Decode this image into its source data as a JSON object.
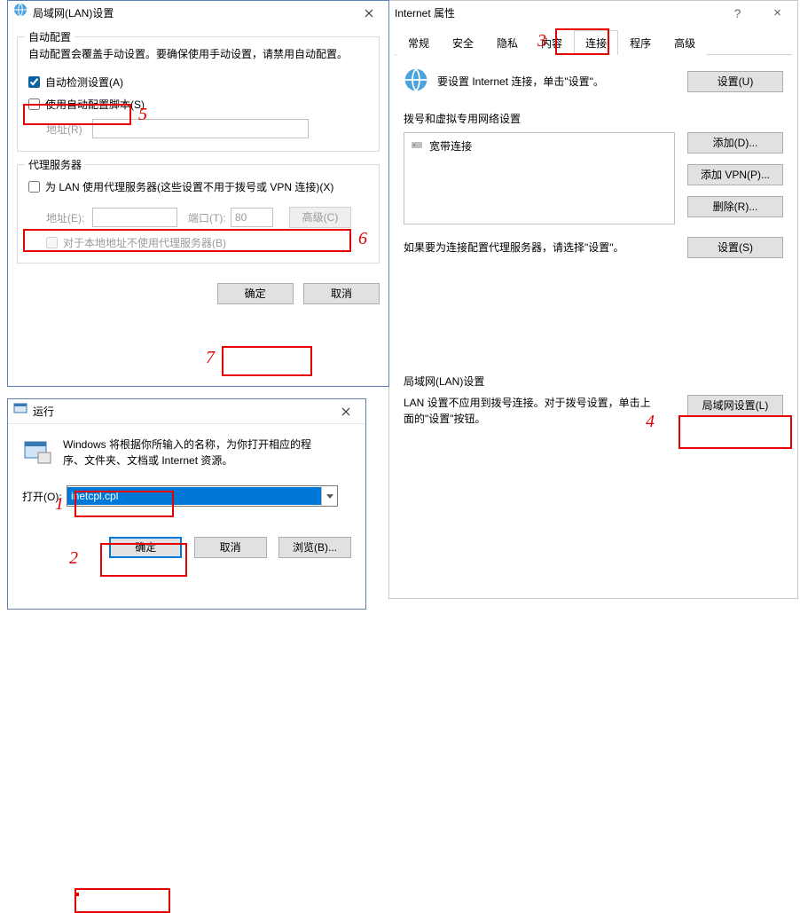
{
  "internet_props": {
    "title": "Internet 属性",
    "help_icon": "?",
    "close_icon": "×",
    "tabs": {
      "general": "常规",
      "security": "安全",
      "privacy": "隐私",
      "content": "内容",
      "connections": "连接",
      "programs": "程序",
      "advanced": "高级"
    },
    "setup_text": "要设置 Internet 连接，单击\"设置\"。",
    "btn_setup": "设置(U)",
    "dialup_legend": "拨号和虚拟专用网络设置",
    "dialup_item": "宽带连接",
    "btn_add": "添加(D)...",
    "btn_add_vpn": "添加 VPN(P)...",
    "btn_delete": "删除(R)...",
    "proxy_note": "如果要为连接配置代理服务器，请选择\"设置\"。",
    "btn_settings": "设置(S)",
    "lan_legend": "局域网(LAN)设置",
    "lan_note": "LAN 设置不应用到拨号连接。对于拨号设置，单击上面的\"设置\"按钮。",
    "btn_lan": "局域网设置(L)"
  },
  "lan_dialog": {
    "title": "局域网(LAN)设置",
    "auto_legend": "自动配置",
    "auto_note": "自动配置会覆盖手动设置。要确保使用手动设置，请禁用自动配置。",
    "chk_auto_detect": "自动检测设置(A)",
    "chk_auto_script": "使用自动配置脚本(S)",
    "addr_label": "地址(R)",
    "proxy_legend": "代理服务器",
    "chk_proxy": "为 LAN 使用代理服务器(这些设置不用于拨号或 VPN 连接)(X)",
    "addr2_label": "地址(E):",
    "port_label": "端口(T):",
    "port_value": "80",
    "btn_advanced": "高级(C)",
    "chk_bypass": "对于本地地址不使用代理服务器(B)",
    "btn_ok": "确定",
    "btn_cancel": "取消"
  },
  "run_dialog": {
    "title": "运行",
    "description": "Windows 将根据你所输入的名称，为你打开相应的程序、文件夹、文档或 Internet 资源。",
    "open_label": "打开(O):",
    "open_value": "inetcpl.cpl",
    "btn_ok": "确定",
    "btn_cancel": "取消",
    "btn_browse": "浏览(B)..."
  },
  "annotations": {
    "n1": "1",
    "n2": "2",
    "n3": "3",
    "n4": "4",
    "n5": "5",
    "n6": "6",
    "n7": "7"
  }
}
